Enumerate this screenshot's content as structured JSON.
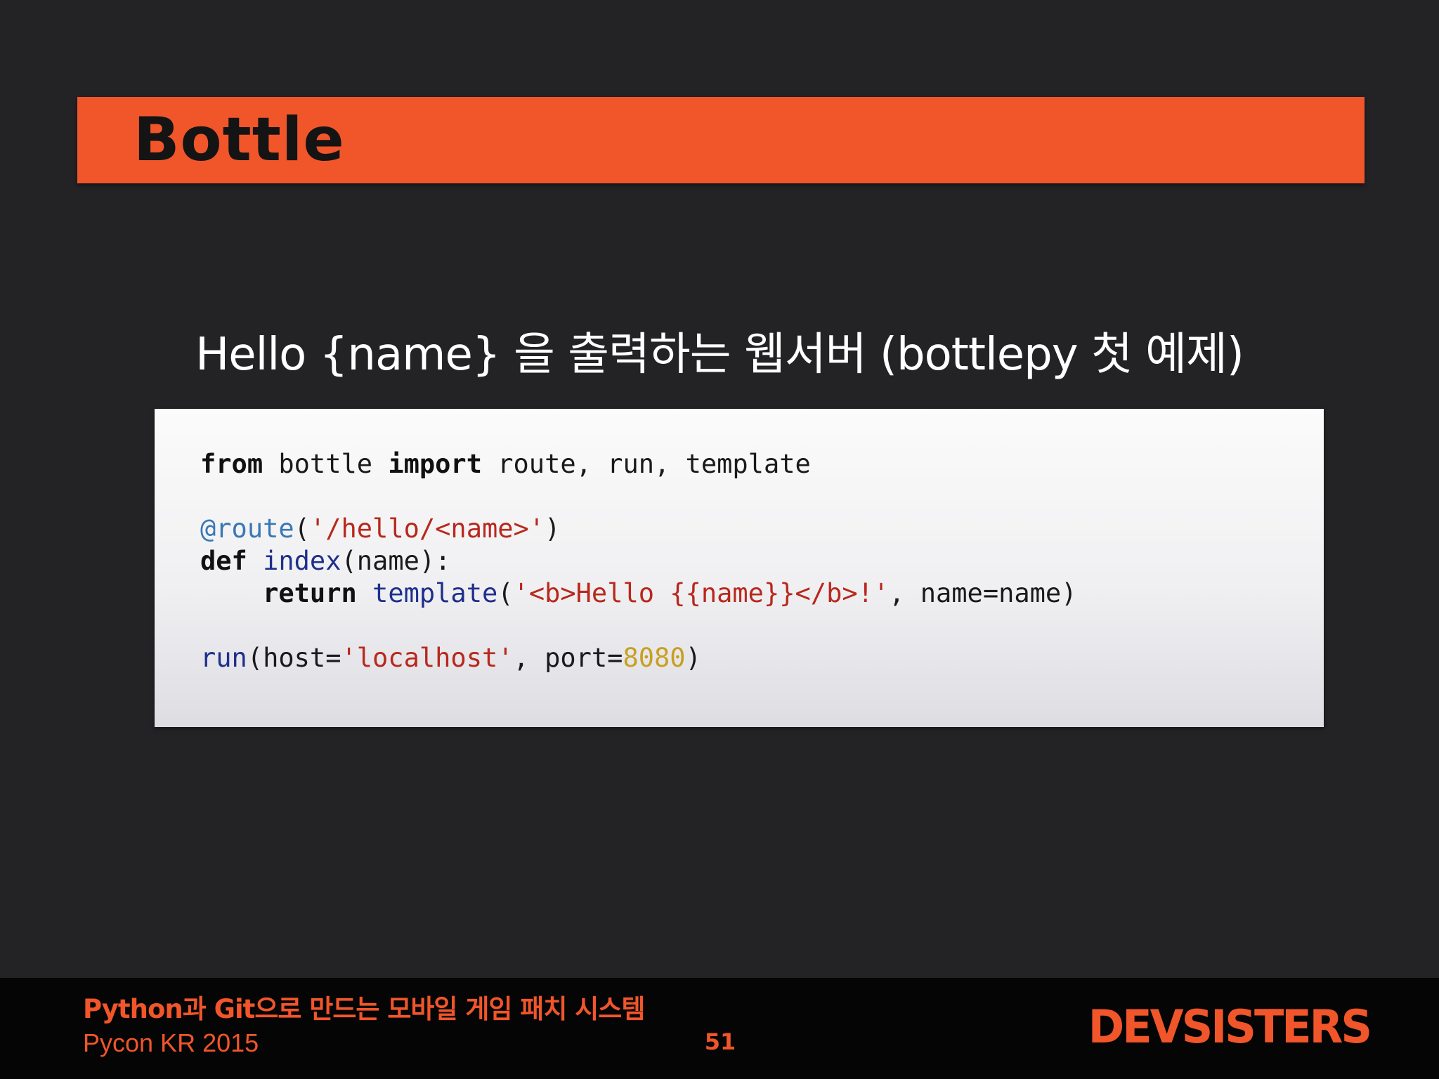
{
  "slide": {
    "title": "Bottle",
    "subtitle": "Hello {name} 을 출력하는 웹서버 (bottlepy 첫 예제)"
  },
  "code": {
    "line1": {
      "t1": "from",
      "t2": " bottle ",
      "t3": "import",
      "t4": " route, run, template"
    },
    "line3": {
      "t1": "@route",
      "t2": "(",
      "t3": "'/hello/<name>'",
      "t4": ")"
    },
    "line4": {
      "t1": "def",
      "t2": " ",
      "t3": "index",
      "t4": "(name):"
    },
    "line5": {
      "t0": "    ",
      "t1": "return",
      "t2": " ",
      "t3": "template",
      "t4": "(",
      "t5": "'<b>Hello {{name}}</b>!'",
      "t6": ", name=name)"
    },
    "line7": {
      "t1": "run",
      "t2": "(host=",
      "t3": "'localhost'",
      "t4": ", port=",
      "t5": "8080",
      "t6": ")"
    }
  },
  "footer": {
    "talk_title": "Python과 Git으로 만드는 모바일 게임 패치 시스템",
    "event": "Pycon KR 2015",
    "page_number": "51",
    "logo": "DEVSISTERS"
  },
  "colors": {
    "accent": "#f1552a",
    "background": "#232325",
    "footer_background": "#050505"
  }
}
